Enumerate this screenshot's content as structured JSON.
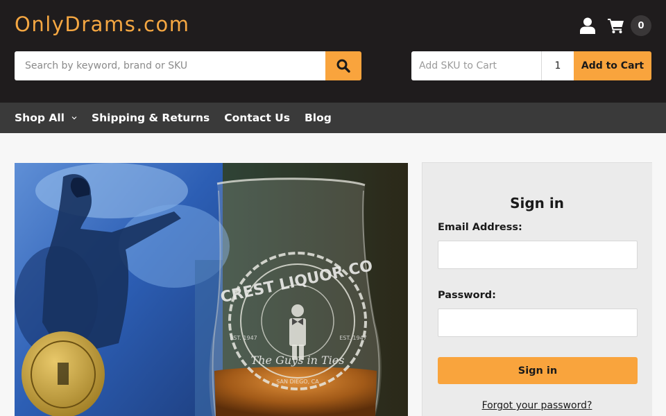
{
  "header": {
    "logo": "OnlyDrams.com",
    "cart_count": "0",
    "user_icon": "user-icon",
    "cart_icon": "cart-icon"
  },
  "search": {
    "placeholder": "Search by keyword, brand or SKU",
    "value": "",
    "icon": "search-icon"
  },
  "quick_add": {
    "sku_placeholder": "Add SKU to Cart",
    "quantity": "1",
    "button_label": "Add to Cart"
  },
  "nav": {
    "items": [
      {
        "label": "Shop All",
        "has_dropdown": true
      },
      {
        "label": "Shipping & Returns"
      },
      {
        "label": "Contact Us"
      },
      {
        "label": "Blog"
      }
    ]
  },
  "hero": {
    "seal_text_top": "CREST LIQUOR CO",
    "seal_tagline": "The Guys in Ties",
    "seal_est_left": "EST. 1947",
    "seal_est_right": "EST. 1947",
    "seal_bottom": "SAN DIEGO, CA"
  },
  "signin": {
    "title": "Sign in",
    "email_label": "Email Address:",
    "email_value": "",
    "password_label": "Password:",
    "password_value": "",
    "button_label": "Sign in",
    "forgot_link": "Forgot your password?"
  },
  "colors": {
    "header_bg": "#1f1c1d",
    "nav_bg": "#3a3a3a",
    "accent": "#f9a43d",
    "logo": "#f5a742"
  }
}
